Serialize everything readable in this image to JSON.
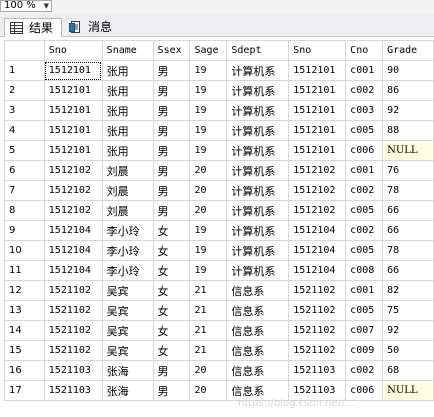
{
  "zoom": {
    "value": "100 %"
  },
  "tabs": [
    {
      "label": "结果",
      "icon": "grid-icon",
      "active": true
    },
    {
      "label": "消息",
      "icon": "message-icon",
      "active": false
    }
  ],
  "grid": {
    "columns": [
      "Sno",
      "Sname",
      "Ssex",
      "Sage",
      "Sdept",
      "Sno",
      "Cno",
      "Grade"
    ],
    "rows": [
      [
        "1",
        "1512101",
        "张用",
        "男",
        "19",
        "计算机系",
        "1512101",
        "c001",
        "90"
      ],
      [
        "2",
        "1512101",
        "张用",
        "男",
        "19",
        "计算机系",
        "1512101",
        "c002",
        "86"
      ],
      [
        "3",
        "1512101",
        "张用",
        "男",
        "19",
        "计算机系",
        "1512101",
        "c003",
        "92"
      ],
      [
        "4",
        "1512101",
        "张用",
        "男",
        "19",
        "计算机系",
        "1512101",
        "c005",
        "88"
      ],
      [
        "5",
        "1512101",
        "张用",
        "男",
        "19",
        "计算机系",
        "1512101",
        "c006",
        "NULL"
      ],
      [
        "6",
        "1512102",
        "刘晨",
        "男",
        "20",
        "计算机系",
        "1512102",
        "c001",
        "76"
      ],
      [
        "7",
        "1512102",
        "刘晨",
        "男",
        "20",
        "计算机系",
        "1512102",
        "c002",
        "78"
      ],
      [
        "8",
        "1512102",
        "刘晨",
        "男",
        "20",
        "计算机系",
        "1512102",
        "c005",
        "66"
      ],
      [
        "9",
        "1512104",
        "李小玲",
        "女",
        "19",
        "计算机系",
        "1512104",
        "c002",
        "66"
      ],
      [
        "10",
        "1512104",
        "李小玲",
        "女",
        "19",
        "计算机系",
        "1512104",
        "c005",
        "78"
      ],
      [
        "11",
        "1512104",
        "李小玲",
        "女",
        "19",
        "计算机系",
        "1512104",
        "c008",
        "66"
      ],
      [
        "12",
        "1521102",
        "吴宾",
        "女",
        "21",
        "信息系",
        "1521102",
        "c001",
        "82"
      ],
      [
        "13",
        "1521102",
        "吴宾",
        "女",
        "21",
        "信息系",
        "1521102",
        "c005",
        "75"
      ],
      [
        "14",
        "1521102",
        "吴宾",
        "女",
        "21",
        "信息系",
        "1521102",
        "c007",
        "92"
      ],
      [
        "15",
        "1521102",
        "吴宾",
        "女",
        "21",
        "信息系",
        "1521102",
        "c009",
        "50"
      ],
      [
        "16",
        "1521103",
        "张海",
        "男",
        "20",
        "信息系",
        "1521103",
        "c002",
        "68"
      ],
      [
        "17",
        "1521103",
        "张海",
        "男",
        "20",
        "信息系",
        "1521103",
        "c006",
        "NULL"
      ]
    ]
  },
  "colors": {
    "null_background": "#ffffe1",
    "grid_line": "#d6d6d6"
  }
}
